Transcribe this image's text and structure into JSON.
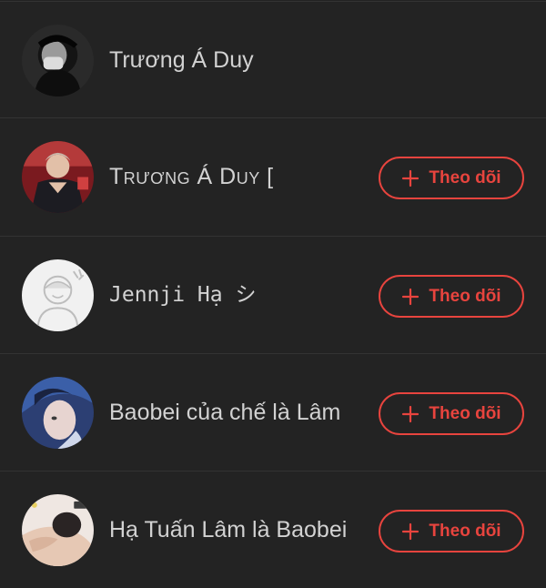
{
  "users": [
    {
      "name": "Trương Á Duy",
      "follow_label": ""
    },
    {
      "name": "Trương Á Duy [",
      "follow_label": "Theo dõi"
    },
    {
      "name": "Jennji Hạ シ",
      "follow_label": "Theo dõi"
    },
    {
      "name": "Baobei của chế là Lâm",
      "follow_label": "Theo dõi"
    },
    {
      "name": "Hạ Tuấn Lâm là Baobei",
      "follow_label": "Theo dõi"
    }
  ],
  "colors": {
    "background": "#232323",
    "text": "#d2d2d2",
    "accent": "#e8443e",
    "divider": "#333333"
  },
  "icons": {
    "follow": "plus-icon"
  }
}
